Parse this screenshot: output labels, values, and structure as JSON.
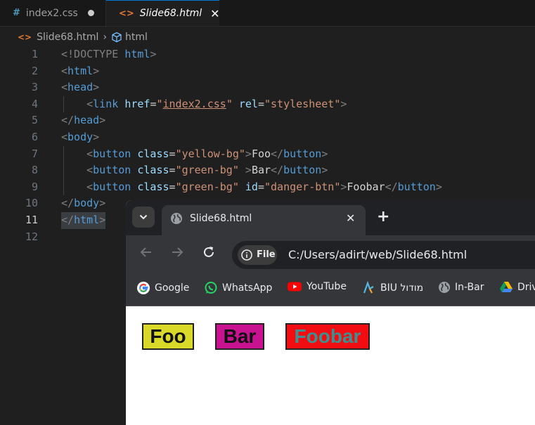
{
  "editor": {
    "tabs": [
      {
        "icon": "#",
        "label": "index2.css",
        "dirty": true
      },
      {
        "icon": "<>",
        "label": "Slide68.html",
        "active": true
      }
    ],
    "breadcrumb": {
      "file": "Slide68.html",
      "symbol": "html",
      "file_icon": "<>"
    },
    "line_numbers": [
      "1",
      "2",
      "3",
      "4",
      "5",
      "6",
      "7",
      "8",
      "9",
      "10",
      "11",
      "12"
    ],
    "active_line": "11",
    "code": {
      "l1": {
        "open": "<!DOCTYPE",
        "kw": "html",
        "close": ">"
      },
      "l2": {
        "open": "<",
        "tag": "html",
        "close": ">"
      },
      "l3": {
        "open": "<",
        "tag": "head",
        "close": ">"
      },
      "l4": {
        "open": "<",
        "tag": "link",
        "a1": "href",
        "eq1": "=",
        "v1q": "\"",
        "v1": "index2.css",
        "v1q2": "\"",
        "a2": "rel",
        "eq2": "=",
        "v2": "\"stylesheet\"",
        "close": ">"
      },
      "l5": {
        "open": "</",
        "tag": "head",
        "close": ">"
      },
      "l6": {
        "open": "<",
        "tag": "body",
        "close": ">"
      },
      "l7": {
        "open": "<",
        "tag": "button",
        "a1": "class",
        "eq1": "=",
        "v1": "\"yellow-bg\"",
        "close": ">",
        "text": "Foo",
        "eopen": "</",
        "etag": "button",
        "eclose": ">"
      },
      "l8": {
        "open": "<",
        "tag": "button",
        "a1": "class",
        "eq1": "=",
        "v1": "\"green-bg\"",
        "close": " >",
        "text": "Bar",
        "eopen": "</",
        "etag": "button",
        "eclose": ">"
      },
      "l9": {
        "open": "<",
        "tag": "button",
        "a1": "class",
        "eq1": "=",
        "v1": "\"green-bg\"",
        "a2": "id",
        "eq2": "=",
        "v2": "\"danger-btn\"",
        "close": ">",
        "text": "Foobar",
        "eopen": "</",
        "etag": "button",
        "eclose": ">"
      },
      "l10": {
        "open": "</",
        "tag": "body",
        "close": ">"
      },
      "l11": {
        "open": "</",
        "tag": "html",
        "close": ">"
      }
    }
  },
  "browser": {
    "tab_title": "Slide68.html",
    "tab_close": "✕",
    "new_tab": "+",
    "file_chip": "File",
    "url": "C:/Users/adirt/web/Slide68.html",
    "bookmarks": [
      {
        "label": "Google",
        "icon": "google-icon"
      },
      {
        "label": "WhatsApp",
        "icon": "whatsapp-icon"
      },
      {
        "label": "YouTube",
        "icon": "youtube-icon"
      },
      {
        "label": "BIU מודול",
        "icon": "moodle-icon"
      },
      {
        "label": "In-Bar",
        "icon": "globe-icon"
      },
      {
        "label": "Drive",
        "icon": "drive-icon"
      }
    ],
    "page_buttons": [
      "Foo",
      "Bar",
      "Foobar"
    ]
  },
  "colors": {
    "yellow_bg": "#d9d92a",
    "green_bg": "#c8128f",
    "danger_bg": "#f20d12",
    "danger_text": "#3e8f8f",
    "editor_bg": "#1f1f1f"
  }
}
